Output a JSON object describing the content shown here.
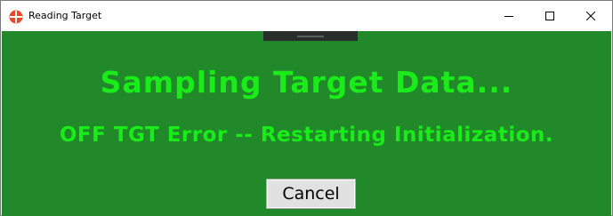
{
  "window": {
    "title": "Reading Target",
    "icon": "target-icon",
    "controls": {
      "minimize": "minimize-icon",
      "maximize": "maximize-icon",
      "close": "close-icon"
    }
  },
  "dialog": {
    "headline": "Sampling Target Data...",
    "status": "OFF TGT Error -- Restarting Initialization.",
    "cancel_label": "Cancel"
  },
  "colors": {
    "background": "#22892a",
    "text": "#19ec19",
    "app_icon": "#e8472c"
  }
}
